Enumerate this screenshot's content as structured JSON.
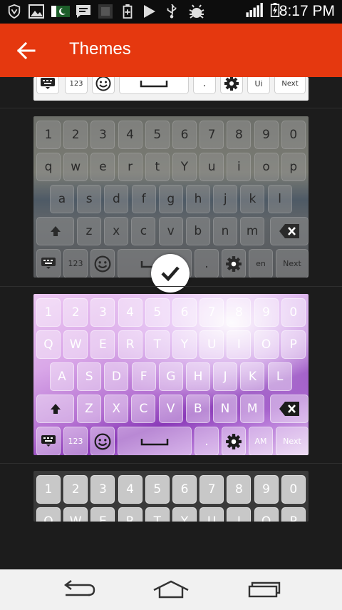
{
  "status_bar": {
    "time": "8:17 PM",
    "icons": [
      "shield-icon",
      "image-icon",
      "pakistan-flag-icon",
      "message-icon",
      "app-icon",
      "battery-saver-icon",
      "play-store-icon",
      "usb-icon",
      "debug-icon",
      "signal-icon",
      "battery-charging-icon"
    ]
  },
  "app_bar": {
    "title": "Themes",
    "back_icon": "arrow-back-icon"
  },
  "colors": {
    "app_bar": "#e5380f",
    "status_bar": "#0d0d0d",
    "background": "#1c1c1c",
    "nav_bar": "#f1f1f1"
  },
  "themes": [
    {
      "name": "white-theme",
      "bottom_row": {
        "num": "123",
        "lang": "Ui",
        "next": "Next"
      }
    },
    {
      "name": "grey-cloud-theme",
      "selected": true,
      "number_row": [
        "1",
        "2",
        "3",
        "4",
        "5",
        "6",
        "7",
        "8",
        "9",
        "0"
      ],
      "row1": [
        "q",
        "w",
        "e",
        "r",
        "t",
        "Y",
        "u",
        "i",
        "o",
        "p"
      ],
      "row2": [
        "a",
        "s",
        "d",
        "f",
        "g",
        "h",
        "j",
        "k",
        "l"
      ],
      "row3": [
        "z",
        "x",
        "c",
        "v",
        "b",
        "n",
        "m"
      ],
      "bottom_row": {
        "num": "123",
        "dot": ".",
        "lang": "en",
        "next": "Next"
      }
    },
    {
      "name": "purple-theme",
      "number_row": [
        "1",
        "2",
        "3",
        "4",
        "5",
        "6",
        "7",
        "8",
        "9",
        "0"
      ],
      "row1": [
        "Q",
        "W",
        "E",
        "R",
        "T",
        "Y",
        "U",
        "I",
        "O",
        "P"
      ],
      "row2": [
        "A",
        "S",
        "D",
        "F",
        "G",
        "H",
        "J",
        "K",
        "L"
      ],
      "row3": [
        "Z",
        "X",
        "C",
        "V",
        "B",
        "N",
        "M"
      ],
      "bottom_row": {
        "num": "123",
        "dot": ".",
        "lang": "AM",
        "next": "Next"
      }
    },
    {
      "name": "light-grey-theme",
      "number_row": [
        "1",
        "2",
        "3",
        "4",
        "5",
        "6",
        "7",
        "8",
        "9",
        "0"
      ],
      "row1": [
        "Q",
        "W",
        "E",
        "R",
        "T",
        "Y",
        "U",
        "I",
        "O",
        "P"
      ]
    }
  ],
  "nav_bar": {
    "buttons": [
      "back-nav-icon",
      "home-nav-icon",
      "recents-nav-icon"
    ]
  }
}
